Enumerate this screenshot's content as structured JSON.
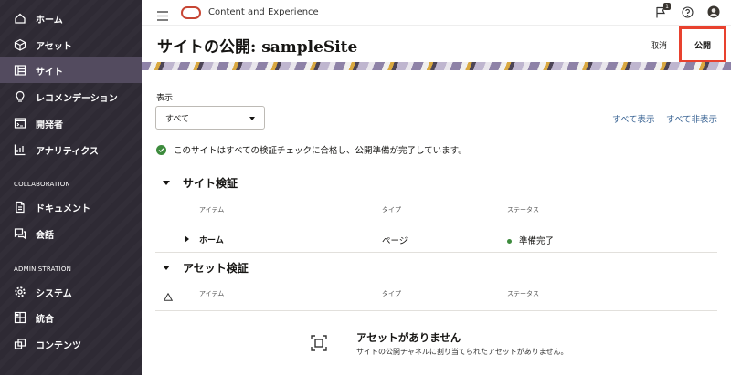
{
  "header": {
    "app_title": "Content and Experience",
    "notification_count": "1"
  },
  "sidebar": {
    "items": [
      {
        "label": "ホーム"
      },
      {
        "label": "アセット"
      },
      {
        "label": "サイト"
      },
      {
        "label": "レコメンデーション"
      },
      {
        "label": "開発者"
      },
      {
        "label": "アナリティクス"
      }
    ],
    "section_collab": "COLLABORATION",
    "collab_items": [
      {
        "label": "ドキュメント"
      },
      {
        "label": "会話"
      }
    ],
    "section_admin": "ADMINISTRATION",
    "admin_items": [
      {
        "label": "システム"
      },
      {
        "label": "統合"
      },
      {
        "label": "コンテンツ"
      }
    ]
  },
  "page": {
    "title": "サイトの公開: sampleSite",
    "cancel_label": "取消",
    "publish_label": "公開"
  },
  "filter": {
    "label": "表示",
    "selected": "すべて",
    "show_all": "すべて表示",
    "hide_all": "すべて非表示"
  },
  "success_message": "このサイトはすべての検証チェックに合格し、公開準備が完了しています。",
  "site_validation": {
    "title": "サイト検証",
    "columns": {
      "item": "アイテム",
      "type": "タイプ",
      "status": "ステータス"
    },
    "rows": [
      {
        "item": "ホーム",
        "type": "ページ",
        "status": "準備完了"
      }
    ]
  },
  "asset_validation": {
    "title": "アセット検証",
    "columns": {
      "item": "アイテム",
      "type": "タイプ",
      "status": "ステータス"
    },
    "empty_title": "アセットがありません",
    "empty_subtitle": "サイトの公開チャネルに割り当てられたアセットがありません。"
  },
  "colors": {
    "sidebar_bg": "#2f2b35",
    "sidebar_active": "#534b5f",
    "publish_highlight": "#e8412e",
    "success_green": "#3d8b3d",
    "link_blue": "#3a6494"
  }
}
